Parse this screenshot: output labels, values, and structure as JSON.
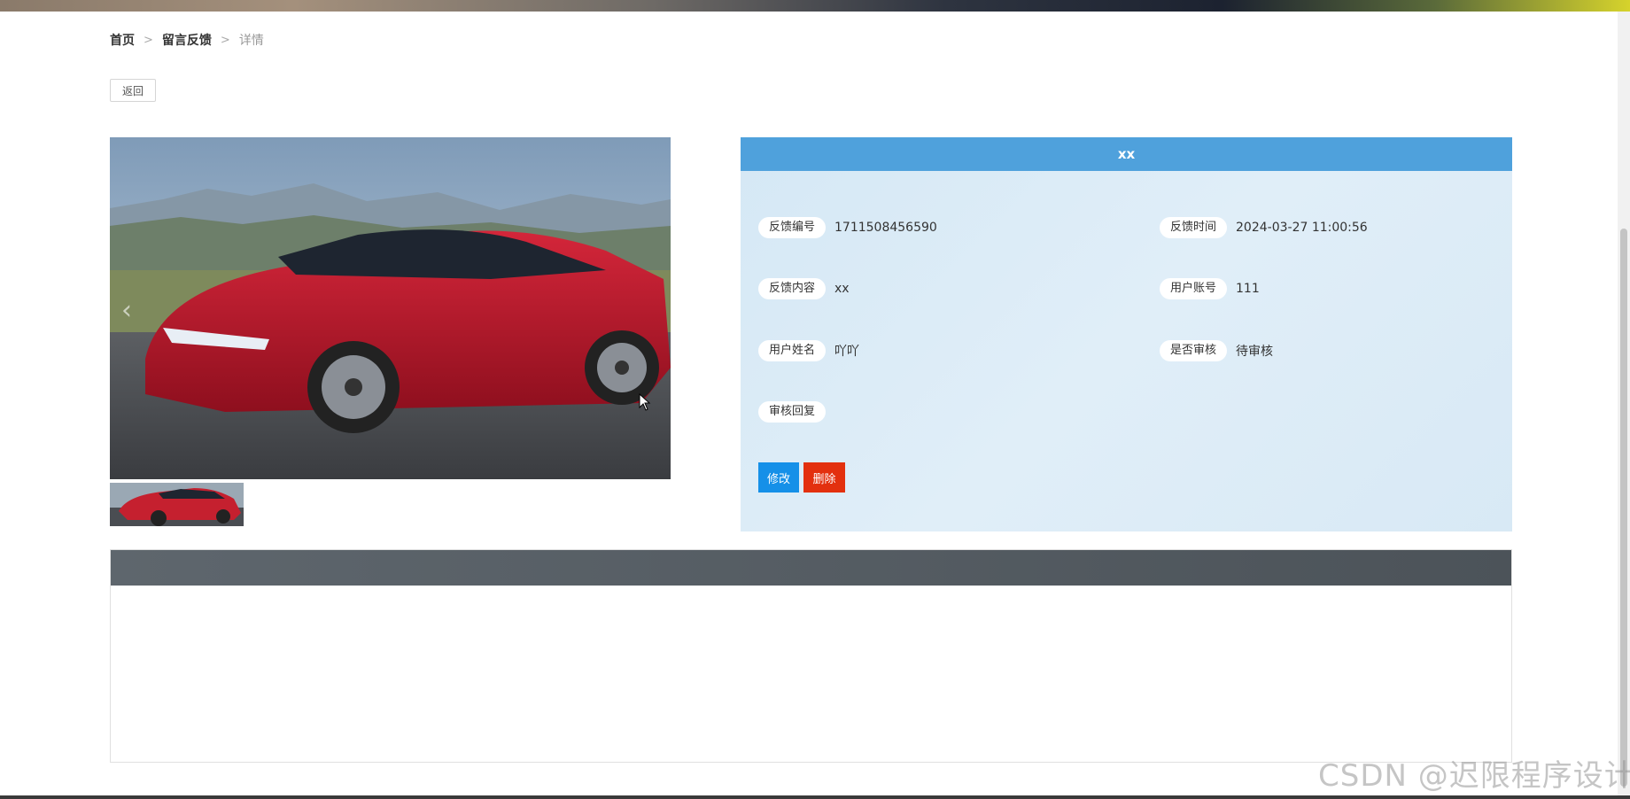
{
  "breadcrumb": {
    "home": "首页",
    "separator_1": ">",
    "section": "留言反馈",
    "separator_2": ">",
    "current": "详情"
  },
  "actions": {
    "back_label": "返回"
  },
  "carousel": {
    "prev_icon": "chevron-left-icon",
    "main_image": "red-sedan-photo",
    "thumbnail": "red-sedan-thumbnail"
  },
  "detail": {
    "title": "xx",
    "fields": {
      "feedback_no": {
        "label": "反馈编号",
        "value": "1711508456590"
      },
      "feedback_time": {
        "label": "反馈时间",
        "value": "2024-03-27 11:00:56"
      },
      "content": {
        "label": "反馈内容",
        "value": "xx"
      },
      "account": {
        "label": "用户账号",
        "value": "111"
      },
      "username": {
        "label": "用户姓名",
        "value": "吖吖"
      },
      "audit_status": {
        "label": "是否审核",
        "value": "待审核"
      },
      "audit_reply": {
        "label": "审核回复",
        "value": ""
      }
    },
    "edit_label": "修改",
    "delete_label": "删除"
  },
  "watermark": "CSDN @迟限程序设计",
  "colors": {
    "header_blue": "#4fa1dc",
    "panel_bg": "#d8e9f5",
    "edit_blue": "#1590e8",
    "delete_red": "#e3300e",
    "comment_header": "#555c62"
  }
}
